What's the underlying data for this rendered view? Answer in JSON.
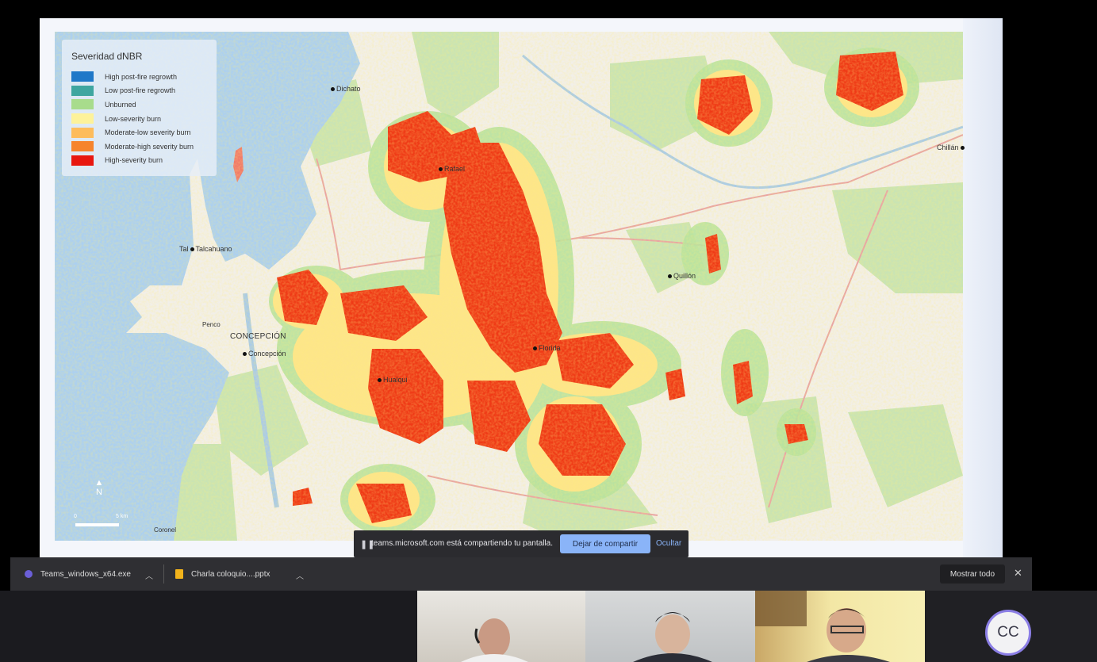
{
  "legend": {
    "title": "Severidad dNBR",
    "items": [
      {
        "label": "High post-fire regrowth",
        "color": "#1f78c8"
      },
      {
        "label": "Low post-fire regrowth",
        "color": "#3fa6a0"
      },
      {
        "label": "Unburned",
        "color": "#a8dc8c"
      },
      {
        "label": "Low-severity burn",
        "color": "#fdf29a"
      },
      {
        "label": "Moderate-low severity burn",
        "color": "#fdbc5c"
      },
      {
        "label": "Moderate-high severity burn",
        "color": "#f6842c"
      },
      {
        "label": "High-severity burn",
        "color": "#e8170f"
      }
    ]
  },
  "map": {
    "cities": {
      "dichato": "Dichato",
      "rafael": "Rafael",
      "chillan": "Chillán",
      "talcahuano_short": "Tal",
      "talcahuano": "Talcahuano",
      "concepcion_big": "CONCEPCIÓN",
      "concepcion": "Concepción",
      "quillon": "Quillón",
      "florida": "Florida",
      "penco": "Penco",
      "hualqui": "Hualqui",
      "coronel": "Coronel"
    },
    "north_label": "N",
    "scale_start": "0",
    "scale_end": "5 km"
  },
  "share_bar": {
    "text": "teams.microsoft.com está compartiendo tu pantalla.",
    "stop_label": "Dejar de compartir",
    "hide_label": "Ocultar"
  },
  "downloads": {
    "items": [
      {
        "name": "Teams_windows_x64.exe"
      },
      {
        "name": "Charla coloquio....pptx"
      }
    ],
    "show_all": "Mostrar todo"
  },
  "participants": {
    "avatar_initials": "CC"
  },
  "colors": {
    "sea": "#acd0f0",
    "land": "#f2efe9",
    "forest": "#c9e4b4",
    "accent": "#8ab4f8"
  }
}
